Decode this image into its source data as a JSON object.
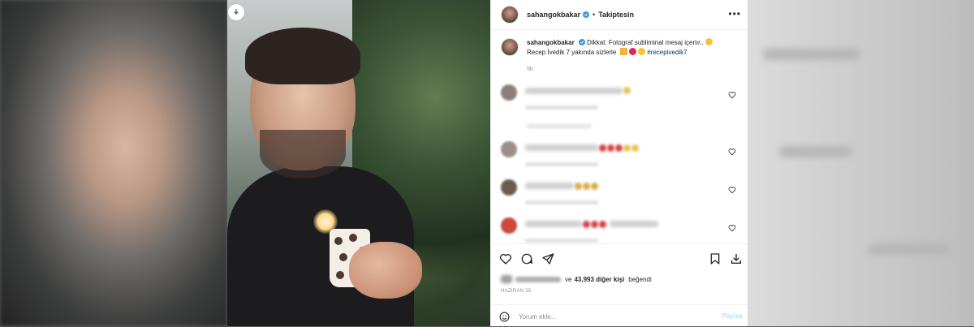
{
  "post": {
    "username": "sahangokbakar",
    "follow_status": "Takiptesin",
    "separator": "•",
    "more": "•••",
    "caption_text": "Dikkat: Fotograf subliminal mesaj içeriır..",
    "caption_line2": "Recep İvedik 7 yakında sizlerle",
    "hashtag": "#recepivedik7",
    "time_ago": "5h",
    "likes_prefix": "ve",
    "likes_count": "43,993 diğer kişi",
    "likes_suffix": "beğendi",
    "date": "HAZİRAN 25",
    "comment_placeholder": "Yorum ekle...",
    "post_button": "Paylaş"
  },
  "icons": {
    "download": "download-icon",
    "verified": "verified-badge-icon",
    "like": "heart-icon",
    "comment": "comment-icon",
    "share": "paper-plane-icon",
    "save": "bookmark-icon",
    "emoji": "smiley-icon"
  },
  "colors": {
    "accent": "#0095f6",
    "verified": "#3897f0",
    "post_disabled": "#b2dffc",
    "hashtag": "#00376b"
  }
}
